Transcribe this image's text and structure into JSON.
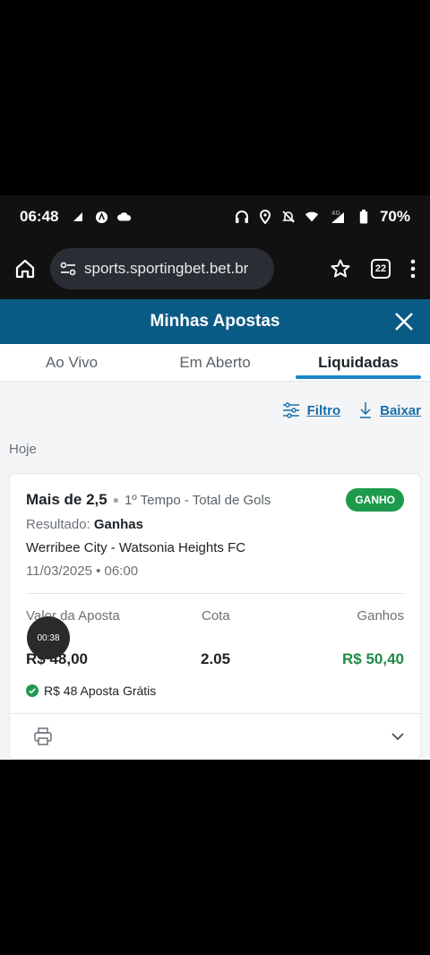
{
  "status_bar": {
    "time": "06:48",
    "battery": "70%",
    "network": "4G"
  },
  "browser": {
    "url": "sports.sportingbet.bet.br",
    "tab_count": "22"
  },
  "header": {
    "title": "Minhas Apostas"
  },
  "tabs": [
    {
      "label": "Ao Vivo"
    },
    {
      "label": "Em Aberto"
    },
    {
      "label": "Liquidadas"
    }
  ],
  "actions": {
    "filter_label": "Filtro",
    "download_label": "Baixar"
  },
  "section": {
    "label": "Hoje"
  },
  "bet": {
    "market": "Mais de 2,5",
    "description": "1º Tempo - Total de Gols",
    "status": "GANHO",
    "result_label": "Resultado:",
    "result_value": "Ganhas",
    "teams": "Werribee City - Watsonia Heights FC",
    "date": "11/03/2025 • 06:00",
    "stake_label": "Valor da Aposta",
    "odds_label": "Cota",
    "winnings_label": "Ganhos",
    "stake_value": "R$ 48,00",
    "odds_value": "2.05",
    "winnings_value": "R$ 50,40",
    "free_bet_text": "R$ 48 Aposta Grátis"
  },
  "overlay": {
    "timer": "00:38"
  },
  "colors": {
    "header_bg": "#0a5a86",
    "accent": "#1a87c9",
    "win_green": "#1e9a4d"
  }
}
